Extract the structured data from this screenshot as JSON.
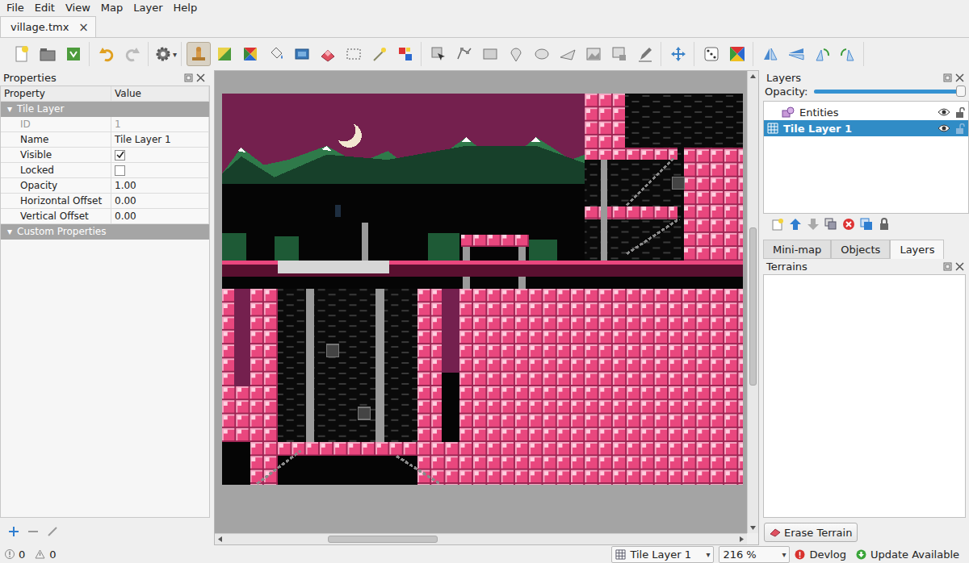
{
  "window": {
    "menu": [
      "File",
      "Edit",
      "View",
      "Map",
      "Layer",
      "Help"
    ]
  },
  "document_tabs": [
    {
      "label": "village.tmx",
      "close": "×",
      "selected": true
    }
  ],
  "toolbar": [
    [
      {
        "selected": false
      },
      {
        "selected": false
      },
      {
        "selected": false
      }
    ],
    [
      {
        "selected": false
      },
      {
        "selected": false
      }
    ],
    [
      {
        "selected": false,
        "menu": "▾"
      }
    ],
    [
      {
        "selected": true
      },
      {
        "selected": false
      },
      {
        "selected": false
      },
      {
        "selected": false
      },
      {
        "selected": false
      },
      {
        "selected": false
      },
      {
        "selected": false
      },
      {
        "selected": false
      },
      {
        "selected": false
      }
    ],
    [
      {
        "selected": false
      },
      {
        "selected": false
      },
      {
        "selected": false
      },
      {
        "selected": false
      },
      {
        "selected": false
      },
      {
        "selected": false
      },
      {
        "selected": false
      },
      {
        "selected": false
      },
      {
        "selected": false
      }
    ],
    [
      {
        "selected": false
      }
    ],
    [
      {
        "selected": false
      },
      {
        "selected": false
      }
    ],
    [
      {
        "selected": false
      },
      {
        "selected": false
      },
      {
        "selected": false
      },
      {
        "selected": false
      }
    ]
  ],
  "properties": {
    "title": "Properties",
    "columns": [
      "Property",
      "Value"
    ],
    "groups": [
      {
        "name": "Tile Layer",
        "toggle": "▾",
        "expanded": true,
        "rows": [
          {
            "name": "ID",
            "kind": "text",
            "value": "1",
            "disabled": true
          },
          {
            "name": "Name",
            "kind": "text",
            "value": "Tile Layer 1",
            "disabled": false
          },
          {
            "name": "Visible",
            "kind": "checkbox",
            "checked": true,
            "disabled": false
          },
          {
            "name": "Locked",
            "kind": "checkbox",
            "checked": false,
            "disabled": false
          },
          {
            "name": "Opacity",
            "kind": "text",
            "value": "1.00",
            "disabled": false
          },
          {
            "name": "Horizontal Offset",
            "kind": "text",
            "value": "0.00",
            "disabled": false
          },
          {
            "name": "Vertical Offset",
            "kind": "text",
            "value": "0.00",
            "disabled": false
          }
        ]
      },
      {
        "name": "Custom Properties",
        "toggle": "▾",
        "expanded": true,
        "rows": []
      }
    ]
  },
  "scroll": {
    "horizontal": {
      "start": 0.2,
      "size": 0.215
    },
    "vertical": {
      "start": 0.33,
      "size": 0.36
    }
  },
  "layers": {
    "title": "Layers",
    "opacity_label": "Opacity:",
    "opacity_level": 1.0,
    "items": [
      {
        "name": "Entities",
        "kind": "object",
        "selected": false,
        "visible": true,
        "locked": false
      },
      {
        "name": "Tile Layer 1",
        "kind": "tile",
        "selected": true,
        "visible": true,
        "locked": false
      }
    ]
  },
  "panel_tabs": [
    {
      "label": "Mini-map",
      "selected": false
    },
    {
      "label": "Objects",
      "selected": false
    },
    {
      "label": "Layers",
      "selected": true
    }
  ],
  "terrains": {
    "title": "Terrains",
    "button": "Erase Terrain"
  },
  "status_bar": {
    "errors": "0",
    "warnings": "0",
    "layer_select": "Tile Layer 1",
    "zoom": "216 %",
    "dropdown": "▾",
    "devlog": "Devlog",
    "update": "Update Available"
  }
}
